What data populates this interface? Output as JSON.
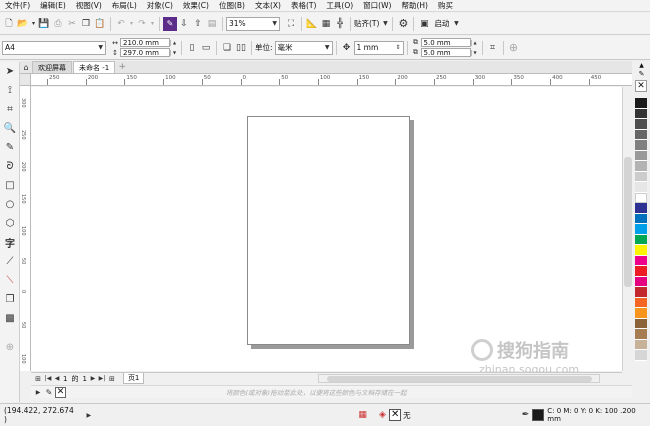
{
  "menu": [
    "文件(F)",
    "编辑(E)",
    "视图(V)",
    "布局(L)",
    "对象(C)",
    "效果(C)",
    "位图(B)",
    "文本(X)",
    "表格(T)",
    "工具(O)",
    "窗口(W)",
    "帮助(H)",
    "购买"
  ],
  "toolbar": {
    "zoom_value": "31%",
    "snap_label": "贴齐(T)",
    "launch_label": "启动"
  },
  "property_bar": {
    "page_size": "A4",
    "width": "210.0 mm",
    "height": "297.0 mm",
    "units_label": "单位:",
    "units_value": "毫米",
    "nudge_value": "1 mm",
    "dup_x": "5.0 mm",
    "dup_y": "5.0 mm"
  },
  "tabs": [
    {
      "label": "欢迎屏幕",
      "active": false
    },
    {
      "label": "未命名 -1",
      "active": true
    }
  ],
  "ruler": {
    "h_ticks": [
      "250",
      "200",
      "150",
      "100",
      "50",
      "0",
      "50",
      "100",
      "150",
      "200",
      "250",
      "300",
      "350",
      "400",
      "450"
    ],
    "v_ticks": [
      "300",
      "250",
      "200",
      "150",
      "100",
      "50",
      "0",
      "50",
      "100"
    ]
  },
  "palette_colors": [
    "#1a1a1a",
    "#333333",
    "#4d4d4d",
    "#666666",
    "#808080",
    "#999999",
    "#b3b3b3",
    "#cccccc",
    "#e6e6e6",
    "#ffffff",
    "#2e3192",
    "#0071bc",
    "#00a0e9",
    "#00a651",
    "#fff200",
    "#ec008c",
    "#ed1c24",
    "#e4007f",
    "#c1272d",
    "#f26522",
    "#f7941d",
    "#8c6239",
    "#a67c52",
    "#c7b299",
    "#d6d6d6"
  ],
  "page_nav": {
    "page_index": "1",
    "of_label": "的",
    "page_total": "1",
    "page_tab": "页1"
  },
  "hint_text": "将颜色(或对象)拖动至此处，以便将这些颜色与文档存储在一起",
  "status": {
    "cursor_pos": "(194.422, 272.674 )",
    "fill_none_label": "无",
    "outline_info": "C: 0 M: 0 Y: 0 K: 100  .200 mm"
  },
  "watermark": {
    "logo_text": "搜狗指南",
    "url": "zhinan.sogou.com"
  }
}
